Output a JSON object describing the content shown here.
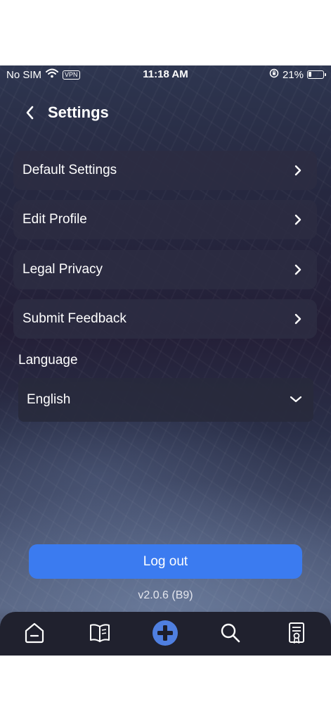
{
  "status_bar": {
    "carrier": "No SIM",
    "vpn": "VPN",
    "time": "11:18 AM",
    "battery_percent": "21%",
    "battery_level": 0.21
  },
  "header": {
    "title": "Settings"
  },
  "menu": {
    "items": [
      {
        "label": "Default Settings"
      },
      {
        "label": "Edit Profile"
      },
      {
        "label": "Legal Privacy"
      },
      {
        "label": "Submit Feedback"
      }
    ]
  },
  "language": {
    "label": "Language",
    "selected": "English"
  },
  "logout": {
    "label": "Log out"
  },
  "version": "v2.0.6 (B9)",
  "tabbar": {
    "tabs": [
      {
        "icon": "home-icon"
      },
      {
        "icon": "book-icon"
      },
      {
        "icon": "add-icon",
        "active_color": "#4f7fe0"
      },
      {
        "icon": "search-icon"
      },
      {
        "icon": "certificate-icon"
      }
    ]
  },
  "colors": {
    "accent": "#3b7bf0",
    "row_bg": "#2c2c42",
    "tabbar_bg": "#20212e"
  }
}
